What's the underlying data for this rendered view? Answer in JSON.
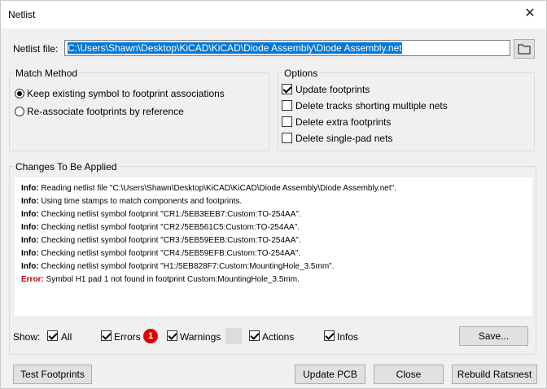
{
  "window": {
    "title": "Netlist",
    "close_glyph": "✕"
  },
  "netlist_file": {
    "label": "Netlist file:",
    "value": "C:\\Users\\Shawn\\Desktop\\KiCAD\\KiCAD\\Diode Assembly\\Diode Assembly.net",
    "browse_icon": "folder-icon"
  },
  "match_method": {
    "title": "Match Method",
    "options": [
      {
        "label": "Keep existing symbol to footprint associations",
        "selected": true
      },
      {
        "label": "Re-associate footprints by reference",
        "selected": false
      }
    ]
  },
  "options": {
    "title": "Options",
    "items": [
      {
        "label": "Update footprints",
        "checked": true
      },
      {
        "label": "Delete tracks shorting multiple nets",
        "checked": false
      },
      {
        "label": "Delete extra footprints",
        "checked": false
      },
      {
        "label": "Delete single-pad nets",
        "checked": false
      }
    ]
  },
  "changes": {
    "title": "Changes To Be Applied",
    "lines": [
      {
        "level": "Info:",
        "text": " Reading netlist file \"C:\\Users\\Shawn\\Desktop\\KiCAD\\KiCAD\\Diode Assembly\\Diode Assembly.net\"."
      },
      {
        "level": "Info:",
        "text": " Using time stamps to match components and footprints."
      },
      {
        "level": "Info:",
        "text": " Checking netlist symbol footprint \"CR1:/5EB3EEB7:Custom:TO-254AA\"."
      },
      {
        "level": "Info:",
        "text": " Checking netlist symbol footprint \"CR2:/5EB561C5:Custom:TO-254AA\"."
      },
      {
        "level": "Info:",
        "text": " Checking netlist symbol footprint \"CR3:/5EB59EEB:Custom:TO-254AA\"."
      },
      {
        "level": "Info:",
        "text": " Checking netlist symbol footprint \"CR4:/5EB59EFB:Custom:TO-254AA\"."
      },
      {
        "level": "Info:",
        "text": " Checking netlist symbol footprint \"H1:/5EB828F7:Custom:MountingHole_3.5mm\"."
      },
      {
        "level": "Error:",
        "text": " Symbol H1 pad 1 not found in footprint Custom:MountingHole_3.5mm."
      }
    ]
  },
  "filter": {
    "show_label": "Show:",
    "all_label": "All",
    "errors_label": "Errors",
    "errors_count": "1",
    "warnings_label": "Warnings",
    "actions_label": "Actions",
    "infos_label": "Infos",
    "save_label": "Save..."
  },
  "buttons": {
    "test_footprints": "Test Footprints",
    "update_pcb": "Update PCB",
    "close": "Close",
    "rebuild_ratsnest": "Rebuild Ratsnest"
  },
  "colors": {
    "selection": "#0078d7",
    "error": "#c00000",
    "badge": "#e00000"
  }
}
